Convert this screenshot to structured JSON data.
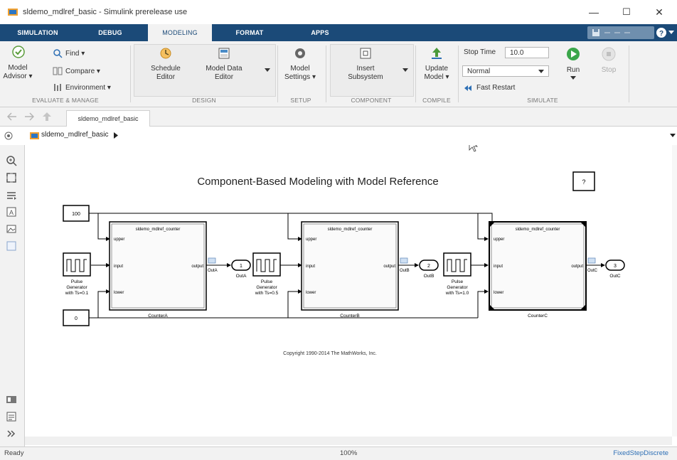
{
  "window": {
    "title": "sldemo_mdlref_basic - Simulink prerelease use",
    "minimize": "—",
    "maximize": "☐",
    "close": "✕"
  },
  "ribbon_tabs": [
    "SIMULATION",
    "DEBUG",
    "MODELING",
    "FORMAT",
    "APPS"
  ],
  "active_tab": "MODELING",
  "ribbon": {
    "evaluate": {
      "model_advisor_1": "Model",
      "model_advisor_2": "Advisor ▾",
      "find": "Find ▾",
      "compare": "Compare ▾",
      "environment": "Environment ▾",
      "group": "EVALUATE & MANAGE"
    },
    "design": {
      "schedule_1": "Schedule",
      "schedule_2": "Editor",
      "modeldata_1": "Model Data",
      "modeldata_2": "Editor",
      "group": "DESIGN"
    },
    "setup": {
      "settings_1": "Model",
      "settings_2": "Settings ▾",
      "group": "SETUP"
    },
    "component": {
      "insert_1": "Insert",
      "insert_2": "Subsystem",
      "group": "COMPONENT"
    },
    "compile": {
      "update_1": "Update",
      "update_2": "Model ▾",
      "group": "COMPILE"
    },
    "simulate": {
      "stop_time_label": "Stop Time",
      "stop_time_value": "10.0",
      "mode": "Normal",
      "fast_restart": "Fast Restart",
      "run": "Run",
      "stop": "Stop",
      "group": "SIMULATE"
    }
  },
  "model_tab": "sldemo_mdlref_basic",
  "breadcrumb": "sldemo_mdlref_basic",
  "diagram": {
    "title": "Component-Based Modeling with Model Reference",
    "help": "?",
    "copyright": "Copyright 1990-2014 The MathWorks, Inc.",
    "const_upper": "100",
    "const_lower": "0",
    "model_ref_name": "sldemo_mdlref_counter",
    "port_upper": "upper",
    "port_input": "input",
    "port_lower": "lower",
    "port_output": "output",
    "pulse_a": [
      "Pulse",
      "Generator",
      "with Ts=0.1"
    ],
    "pulse_b": [
      "Pulse",
      "Generator",
      "with Ts=0.5"
    ],
    "pulse_c": [
      "Pulse",
      "Generator",
      "with Ts=1.0"
    ],
    "counter_a": "CounterA",
    "counter_b": "CounterB",
    "counter_c": "CounterC",
    "out_a_num": "1",
    "out_b_num": "2",
    "out_c_num": "3",
    "out_a": "OutA",
    "out_b": "OutB",
    "out_c": "OutC"
  },
  "status": {
    "left": "Ready",
    "zoom": "100%",
    "solver": "FixedStepDiscrete"
  }
}
